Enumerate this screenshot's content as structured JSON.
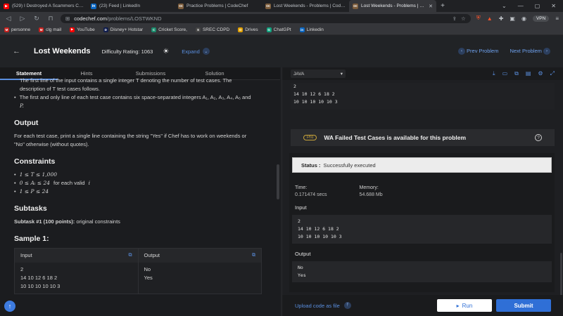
{
  "browser": {
    "tabs": [
      {
        "title": "(529) I Destroyed A Scammers Comp...",
        "fav": "▶",
        "color": "#ff0000"
      },
      {
        "title": "(23) Feed | LinkedIn",
        "fav": "in",
        "color": "#0a66c2"
      },
      {
        "title": "Practice Problems | CodeChef",
        "fav": "cc",
        "color": "#7b5b3a"
      },
      {
        "title": "Lost Weekends - Problems | CodeChef",
        "fav": "cc",
        "color": "#7b5b3a"
      },
      {
        "title": "Lost Weekends - Problems | Code...",
        "fav": "cc",
        "color": "#7b5b3a"
      }
    ],
    "url_host": "codechef.com",
    "url_path": "/problems/LOSTWKND",
    "vpn": "VPN",
    "bookmarks": [
      {
        "label": "personne",
        "ic": "M",
        "color": "#c5221f"
      },
      {
        "label": "clg mail",
        "ic": "M",
        "color": "#c5221f"
      },
      {
        "label": "YouTube",
        "ic": "▶",
        "color": "#ff0000"
      },
      {
        "label": "Disney+ Hotstar",
        "ic": "D",
        "color": "#0f1c4d"
      },
      {
        "label": "Cricket Score,",
        "ic": "C",
        "color": "#1a8a6b"
      },
      {
        "label": "SREC CDPD",
        "ic": "S",
        "color": "#444"
      },
      {
        "label": "Drives",
        "ic": "D",
        "color": "#e0a000"
      },
      {
        "label": "ChatGPt",
        "ic": "G",
        "color": "#10a37f"
      },
      {
        "label": "Linkedin",
        "ic": "in",
        "color": "#0a66c2"
      }
    ]
  },
  "header": {
    "title": "Lost Weekends",
    "rating": "Difficulty Rating: 1063",
    "expand": "Expand",
    "prev": "Prev Problem",
    "next": "Next Problem"
  },
  "left_tabs": [
    "Statement",
    "Hints",
    "Submissions",
    "Solution"
  ],
  "statement": {
    "intro_1": "The first line of the input contains a single integer T denoting the number of test cases. The",
    "intro_2": "description of T test cases follows.",
    "bullet_2": "The first and only line of each test case contains six space-separated integers A₁, A₂, A₃, A₄, A₅ and",
    "bullet_2b": "P.",
    "output_h": "Output",
    "output_text_1": "For each test case, print a single line containing the string \"Yes\" if Chef has to work on weekends or",
    "output_text_2": "\"No\" otherwise (without quotes).",
    "constraints_h": "Constraints",
    "c1": "1 ≤ T ≤ 1,000",
    "c2": "0 ≤ Aᵢ ≤ 24",
    "c2_tail": "for each valid",
    "c2_i": "i",
    "c3": "1 ≤ P ≤ 24",
    "subtasks_h": "Subtasks",
    "subtask_1": "Subtask #1 (100 points):",
    "subtask_1_tail": "original constraints",
    "sample_h": "Sample 1:",
    "input_h": "Input",
    "output_col_h": "Output",
    "input_lines": [
      "2",
      "14 10 12 6 18 2",
      "10 10 10 10 10 3"
    ],
    "output_lines": [
      "No",
      "Yes"
    ]
  },
  "editor": {
    "language": "JAVA",
    "custom_input": [
      "2",
      "14 10 12 6 18 2",
      "10 10 10 10 10 3"
    ]
  },
  "wa_banner": {
    "badge": "Pro",
    "text": "WA Failed Test Cases is available for this problem"
  },
  "result": {
    "status_label": "Status :",
    "status_value": "Successfully executed",
    "time_label": "Time:",
    "time_value": "0.171474 secs",
    "memory_label": "Memory:",
    "memory_value": "54.688 Mb",
    "input_label": "Input",
    "input_lines": [
      "2",
      "14 10 12 6 18 2",
      "10 10 10 10 10 3"
    ],
    "output_label": "Output",
    "output_lines": [
      "No",
      "Yes"
    ]
  },
  "actions": {
    "upload": "Upload code as file",
    "run": "Run",
    "submit": "Submit"
  }
}
